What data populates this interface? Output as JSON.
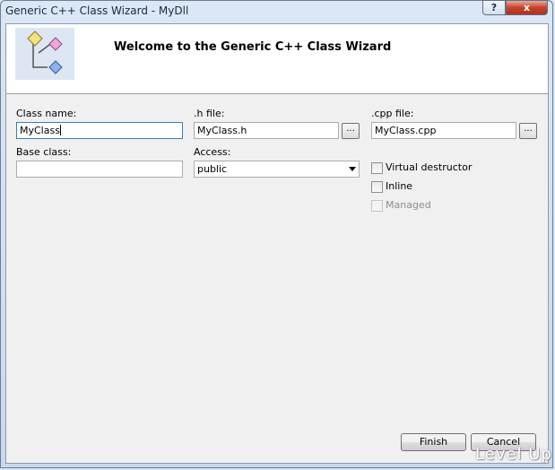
{
  "window": {
    "title": "Generic C++ Class Wizard - MyDll",
    "help_label": "?",
    "close_label": "x"
  },
  "banner": {
    "heading": "Welcome to the Generic C++ Class Wizard",
    "logo_icon": "class-diagram-icon"
  },
  "form": {
    "class_name": {
      "label": "Class name:",
      "value": "MyClass"
    },
    "h_file": {
      "label": ".h file:",
      "value": "MyClass.h",
      "browse_label": "..."
    },
    "cpp_file": {
      "label": ".cpp file:",
      "value": "MyClass.cpp",
      "browse_label": "..."
    },
    "base_class": {
      "label": "Base class:",
      "value": ""
    },
    "access": {
      "label": "Access:",
      "selected": "public"
    },
    "virtual_destructor": {
      "label": "Virtual destructor",
      "checked": false
    },
    "inline": {
      "label": "Inline",
      "checked": false
    },
    "managed": {
      "label": "Managed",
      "checked": false,
      "disabled": true
    }
  },
  "buttons": {
    "finish": "Finish",
    "cancel": "Cancel"
  },
  "watermark": "Level Up"
}
